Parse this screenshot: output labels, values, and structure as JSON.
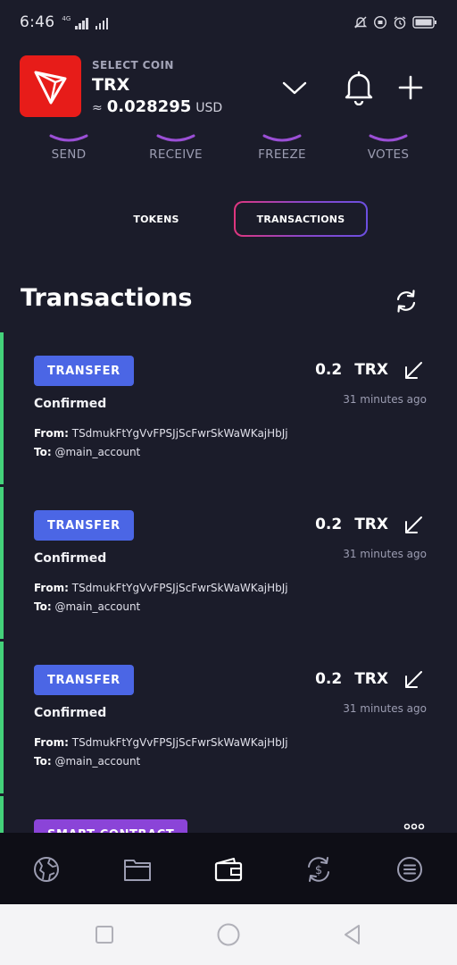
{
  "status_bar": {
    "time": "6:46",
    "network": "4G"
  },
  "header": {
    "select_label": "SELECT COIN",
    "coin_symbol": "TRX",
    "approx_sign": "≈",
    "price_value": "0.028295",
    "price_currency": "USD",
    "logo_color": "#e71c19"
  },
  "actions": [
    {
      "label": "SEND"
    },
    {
      "label": "RECEIVE"
    },
    {
      "label": "FREEZE"
    },
    {
      "label": "VOTES"
    }
  ],
  "tabs": [
    {
      "label": "TOKENS",
      "active": false
    },
    {
      "label": "TRANSACTIONS",
      "active": true
    }
  ],
  "section_title": "Transactions",
  "transactions": [
    {
      "type": "TRANSFER",
      "status": "Confirmed",
      "amount": "0.2",
      "currency": "TRX",
      "time": "31 minutes ago",
      "from_label": "From:",
      "from": "TSdmukFtYgVvFPSJjScFwrSkWaWKajHbJj",
      "to_label": "To:",
      "to": "@main_account"
    },
    {
      "type": "TRANSFER",
      "status": "Confirmed",
      "amount": "0.2",
      "currency": "TRX",
      "time": "31 minutes ago",
      "from_label": "From:",
      "from": "TSdmukFtYgVvFPSJjScFwrSkWaWKajHbJj",
      "to_label": "To:",
      "to": "@main_account"
    },
    {
      "type": "TRANSFER",
      "status": "Confirmed",
      "amount": "0.2",
      "currency": "TRX",
      "time": "31 minutes ago",
      "from_label": "From:",
      "from": "TSdmukFtYgVvFPSJjScFwrSkWaWKajHbJj",
      "to_label": "To:",
      "to": "@main_account"
    }
  ],
  "partial_transaction": {
    "type": "SMART CONTRACT"
  },
  "colors": {
    "background": "#1b1c2a",
    "accent_green": "#44d17a",
    "transfer_badge": "#4b66e5",
    "smart_contract_badge": "#8b44d8",
    "tab_gradient": [
      "#e0367e",
      "#6c4fe0"
    ]
  },
  "bottom_nav": [
    {
      "icon": "globe-icon"
    },
    {
      "icon": "folder-icon"
    },
    {
      "icon": "wallet-icon",
      "active": true
    },
    {
      "icon": "exchange-icon"
    },
    {
      "icon": "menu-icon"
    }
  ]
}
